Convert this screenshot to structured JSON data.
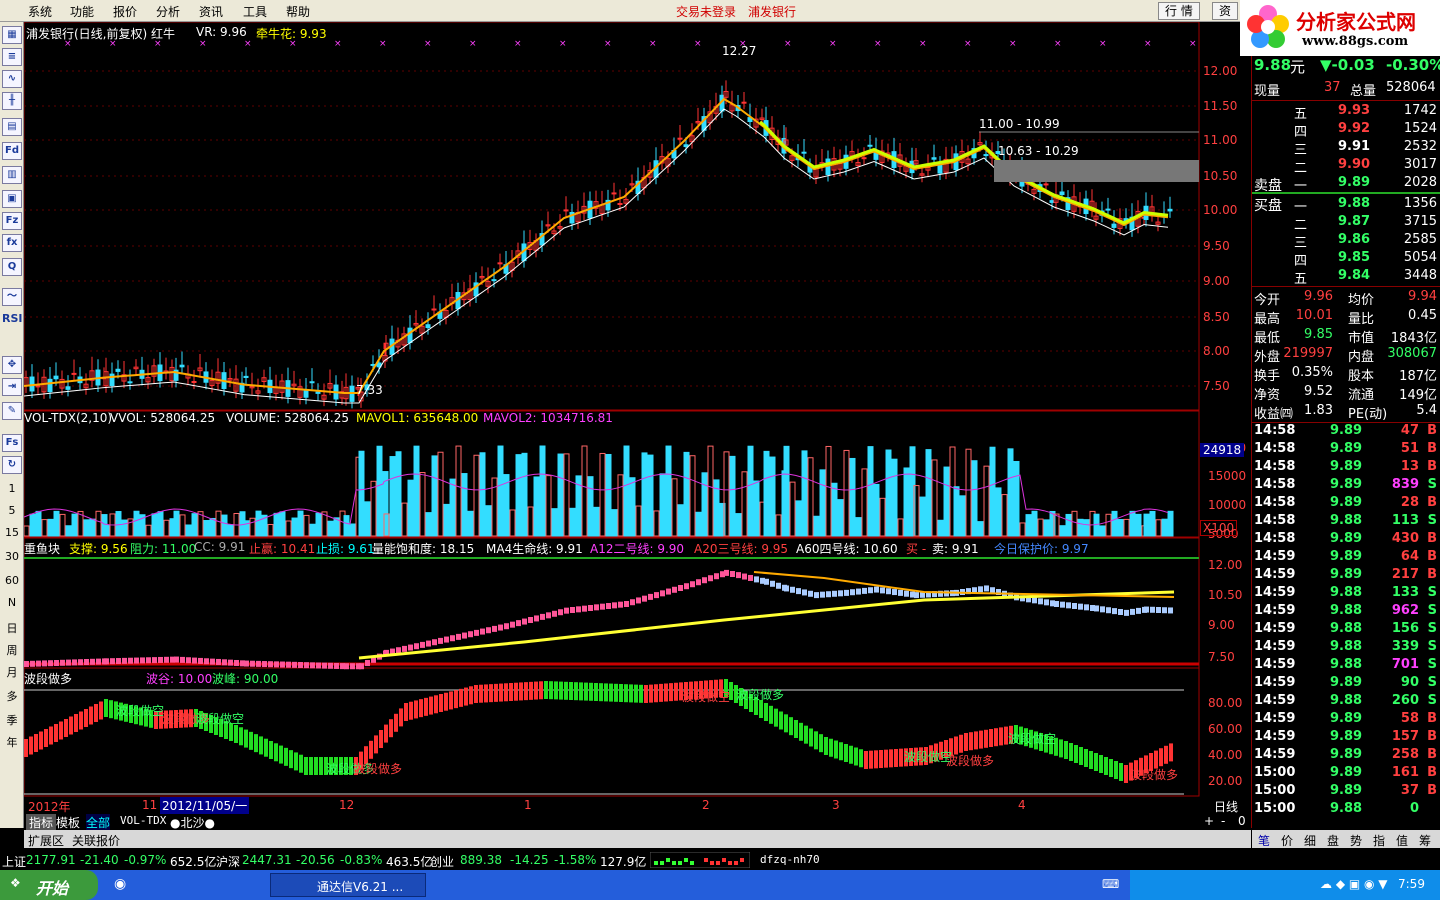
{
  "menu": {
    "items": [
      "系统",
      "功能",
      "报价",
      "分析",
      "资讯",
      "工具",
      "帮助"
    ],
    "center_left": "交易未登录",
    "center_right": "浦发银行",
    "btn_quote": "行 情",
    "btn_trade": "资"
  },
  "logo": {
    "title": "分析家公式网",
    "url": "www.88gs.com"
  },
  "left_toolbar": [
    "RSI",
    "1",
    "5",
    "15",
    "30",
    "60",
    "N",
    "日",
    "周",
    "月",
    "多",
    "季",
    "年"
  ],
  "main": {
    "title": "浦发银行(日线,前复权) 红牛",
    "vr": "VR: 9.96",
    "qnh": "牵牛花: 9.93",
    "peak_label": "12.27",
    "low_label": "7.33",
    "zone_top": "11.00 - 10.99",
    "zone_bottom": "10.63 - 10.29",
    "price_ticks": [
      "12.00",
      "11.50",
      "11.00",
      "10.50",
      "10.00",
      "9.50",
      "9.00",
      "8.50",
      "8.00",
      "7.50"
    ]
  },
  "volume": {
    "title": "VOL-TDX(2,10)",
    "vvol": "VVOL: 528064.25",
    "volume": "VOLUME: 528064.25",
    "mavol1": "MAVOL1: 635648.00",
    "mavol2": "MAVOL2: 1034716.81",
    "ticks": [
      "20000",
      "15000",
      "10000",
      "5000"
    ],
    "current": "24918",
    "scale": "X100"
  },
  "ind3": {
    "name": "重鱼块",
    "support": "支撑: 9.56",
    "resist": "阻力: 11.00",
    "cc": "CC: 9.91",
    "tp": "止赢: 10.41",
    "sl": "止损: 9.61",
    "qty": "量能饱和度: 18.15",
    "ma4": "MA4生命线: 9.91",
    "a12": "A12二号线: 9.90",
    "a20": "A20三号线: 9.95",
    "a60": "A60四号线: 10.60",
    "buy": "买 -",
    "sell": "卖: 9.91",
    "today": "今日保护价: 9.97",
    "ticks": [
      "12.00",
      "10.50",
      "9.00",
      "7.50"
    ]
  },
  "ind4": {
    "name": "波段做多",
    "trough": "波谷: 10.00",
    "peak": "波峰: 90.00",
    "labels": [
      "波段做空",
      "波段做多",
      "波段做空",
      "波段做多",
      "波段做多",
      "波段做空",
      "波段做多",
      "波段做空",
      "波段做多",
      "波段做空",
      "波段做多"
    ],
    "ticks": [
      "80.00",
      "60.00",
      "40.00",
      "20.00"
    ]
  },
  "xaxis": {
    "year": "2012年",
    "m11": "11",
    "cursor": "2012/11/05/一",
    "m12": "12",
    "m1": "1",
    "m2": "2",
    "m3": "3",
    "m4": "4",
    "period": "日线"
  },
  "tabs": {
    "items": [
      "指标",
      "模板",
      "全部",
      "VOL-TDX",
      "●北沙●"
    ],
    "row2": [
      "扩展区",
      "关联报价"
    ],
    "ctrl": [
      "+",
      "-",
      "0"
    ]
  },
  "quote": {
    "price": "9.88",
    "unit": "元",
    "change": "▼-0.03",
    "pct": "-0.30%",
    "xianliang_label": "现量",
    "xianliang": "37",
    "zongliang_label": "总量",
    "zongliang": "528064",
    "sell": [
      [
        "五",
        "9.93",
        "1742"
      ],
      [
        "四",
        "9.92",
        "1524"
      ],
      [
        "三",
        "9.91",
        "2532"
      ],
      [
        "二",
        "9.90",
        "3017"
      ],
      [
        "一",
        "9.89",
        "2028"
      ]
    ],
    "sell_label": "卖盘",
    "buy_label": "买盘",
    "buy": [
      [
        "一",
        "9.88",
        "1356"
      ],
      [
        "二",
        "9.87",
        "3715"
      ],
      [
        "三",
        "9.86",
        "2585"
      ],
      [
        "四",
        "9.85",
        "5054"
      ],
      [
        "五",
        "9.84",
        "3448"
      ]
    ],
    "stats": [
      [
        "今开",
        "9.96",
        "均价",
        "9.94"
      ],
      [
        "最高",
        "10.01",
        "量比",
        "0.45"
      ],
      [
        "最低",
        "9.85",
        "市值",
        "1843亿"
      ],
      [
        "外盘",
        "219997",
        "内盘",
        "308067"
      ],
      [
        "换手",
        "0.35%",
        "股本",
        "187亿"
      ],
      [
        "净资",
        "9.52",
        "流通",
        "149亿"
      ],
      [
        "收益㈣",
        "1.83",
        "PE(动)",
        "5.4"
      ]
    ],
    "ticks": [
      [
        "14:58",
        "9.89",
        "47",
        "B"
      ],
      [
        "14:58",
        "9.89",
        "51",
        "B"
      ],
      [
        "14:58",
        "9.89",
        "13",
        "B"
      ],
      [
        "14:58",
        "9.89",
        "839",
        "S"
      ],
      [
        "14:58",
        "9.89",
        "28",
        "B"
      ],
      [
        "14:58",
        "9.88",
        "113",
        "S"
      ],
      [
        "14:58",
        "9.89",
        "430",
        "B"
      ],
      [
        "14:59",
        "9.89",
        "64",
        "B"
      ],
      [
        "14:59",
        "9.89",
        "217",
        "B"
      ],
      [
        "14:59",
        "9.88",
        "133",
        "S"
      ],
      [
        "14:59",
        "9.88",
        "962",
        "S"
      ],
      [
        "14:59",
        "9.88",
        "156",
        "S"
      ],
      [
        "14:59",
        "9.88",
        "339",
        "S"
      ],
      [
        "14:59",
        "9.88",
        "701",
        "S"
      ],
      [
        "14:59",
        "9.89",
        "90",
        "S"
      ],
      [
        "14:59",
        "9.88",
        "260",
        "S"
      ],
      [
        "14:59",
        "9.89",
        "58",
        "B"
      ],
      [
        "14:59",
        "9.89",
        "157",
        "B"
      ],
      [
        "14:59",
        "9.89",
        "258",
        "B"
      ],
      [
        "15:00",
        "9.89",
        "161",
        "B"
      ],
      [
        "15:00",
        "9.89",
        "37",
        "B"
      ],
      [
        "15:00",
        "9.88",
        "0",
        ""
      ]
    ],
    "tabs": [
      "笔",
      "价",
      "细",
      "盘",
      "势",
      "指",
      "值",
      "筹"
    ]
  },
  "status": {
    "sh": "上证",
    "sh_v": "2177.91",
    "sh_c": "-21.40",
    "sh_p": "-0.97%",
    "sh_a": "652.5亿",
    "hs": "沪深",
    "hs_v": "2447.31",
    "hs_c": "-20.56",
    "hs_p": "-0.83%",
    "hs_a": "463.5亿",
    "cy": "创业",
    "cy_v": "889.38",
    "cy_c": "-14.25",
    "cy_p": "-1.58%",
    "cy_a": "127.9亿",
    "server": "dfzq-nh70"
  },
  "taskbar": {
    "start": "开始",
    "app": "通达信V6.21 ...",
    "time": "7:59"
  }
}
